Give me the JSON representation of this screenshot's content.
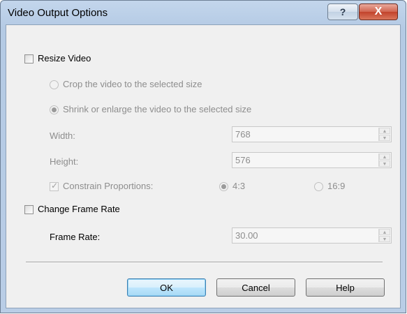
{
  "window": {
    "title": "Video Output Options",
    "help_glyph": "?",
    "close_glyph": "X"
  },
  "resize": {
    "label": "Resize Video",
    "checked": false,
    "crop_label": "Crop the video to the selected size",
    "shrink_label": "Shrink or enlarge the video to the selected size",
    "selected_mode": "shrink"
  },
  "width": {
    "label": "Width:",
    "value": "768"
  },
  "height": {
    "label": "Height:",
    "value": "576"
  },
  "constrain": {
    "label": "Constrain Proportions:",
    "checked": true,
    "check_glyph": "✓",
    "ratio_43": "4:3",
    "ratio_169": "16:9",
    "selected_ratio": "4:3"
  },
  "framerate": {
    "change_label": "Change Frame Rate",
    "checked": false,
    "label": "Frame Rate:",
    "value": "30.00"
  },
  "spin_glyphs": {
    "up": "▲",
    "down": "▼"
  },
  "buttons": {
    "ok": "OK",
    "cancel": "Cancel",
    "help": "Help"
  }
}
